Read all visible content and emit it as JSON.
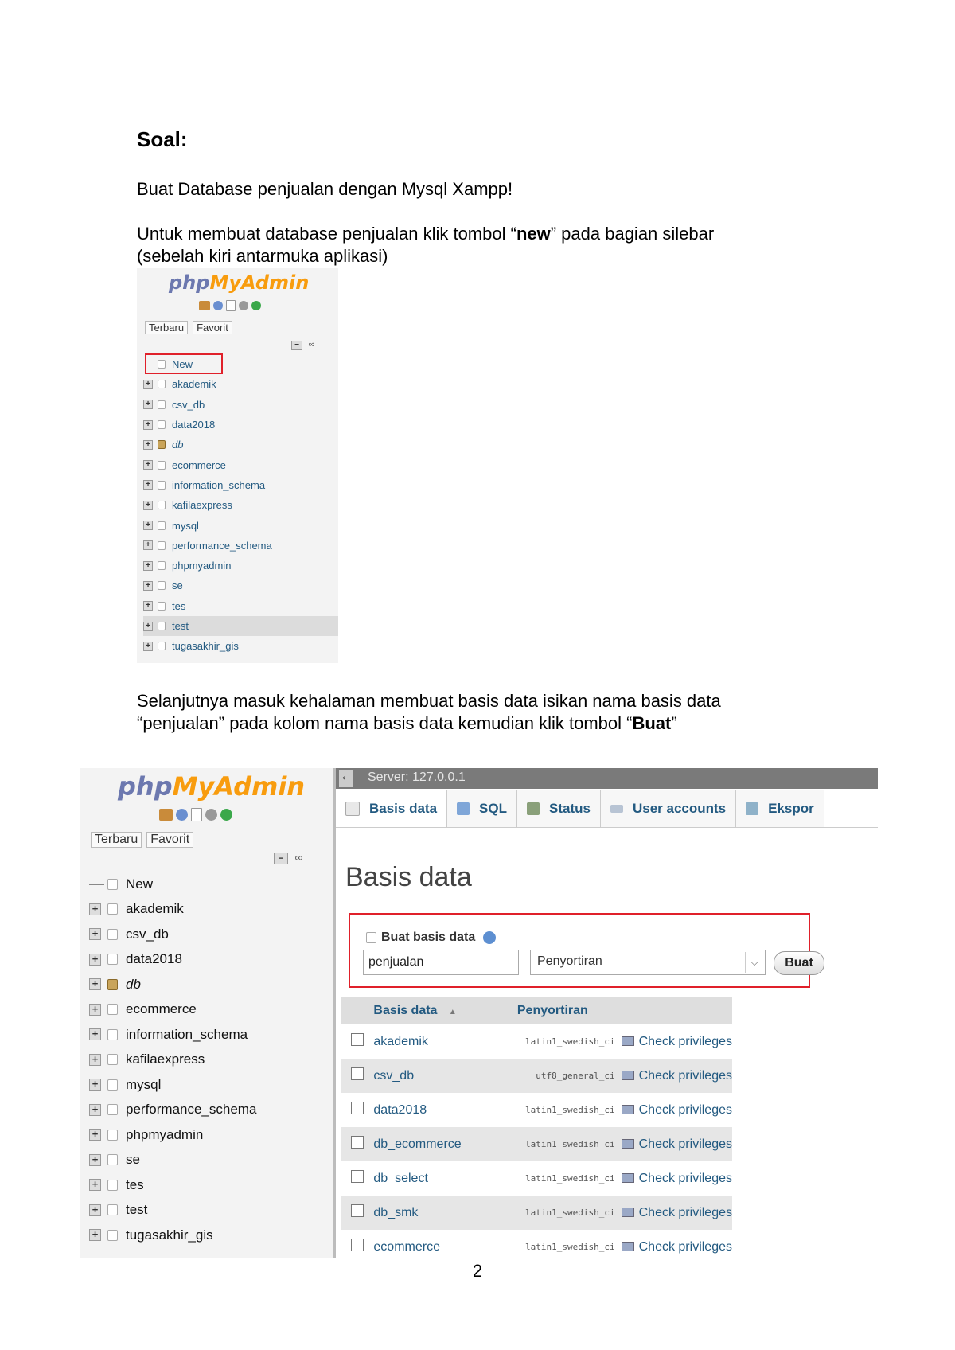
{
  "document": {
    "heading": "Soal:",
    "task": "Buat Database penjualan dengan Mysql Xampp!",
    "step1_before": "Untuk membuat database penjualan klik tombol “",
    "step1_bold": "new",
    "step1_after": "” pada bagian silebar",
    "step1_line2": "(sebelah kiri antarmuka aplikasi)",
    "step2_line1": "Selanjutnya masuk kehalaman membuat basis data isikan nama basis data",
    "step2_line2_before": "“penjualan” pada kolom nama basis data kemudian klik tombol “",
    "step2_bold": "Buat",
    "step2_after": "”",
    "page_number": "2"
  },
  "sidebar": {
    "logo_php": "php",
    "logo_myadmin": "MyAdmin",
    "tab_recent": "Terbaru",
    "tab_favorite": "Favorit",
    "new_label": "New",
    "databases": [
      "akademik",
      "csv_db",
      "data2018",
      "db",
      "ecommerce",
      "information_schema",
      "kafilaexpress",
      "mysql",
      "performance_schema",
      "phpmyadmin",
      "se",
      "tes",
      "test",
      "tugasakhir_gis"
    ]
  },
  "main": {
    "server_label": "Server: 127.0.0.1",
    "tabs": [
      "Basis data",
      "SQL",
      "Status",
      "User accounts",
      "Ekspor"
    ],
    "page_title": "Basis data",
    "create_label": "Buat basis data",
    "db_name_value": "penjualan",
    "collation_placeholder": "Penyortiran",
    "create_button": "Buat",
    "table_headers": {
      "name": "Basis data",
      "collation": "Penyortiran"
    },
    "table_rows": [
      {
        "name": "akademik",
        "collation": "latin1_swedish_ci",
        "privileges": "Check privileges"
      },
      {
        "name": "csv_db",
        "collation": "utf8_general_ci",
        "privileges": "Check privileges"
      },
      {
        "name": "data2018",
        "collation": "latin1_swedish_ci",
        "privileges": "Check privileges"
      },
      {
        "name": "db_ecommerce",
        "collation": "latin1_swedish_ci",
        "privileges": "Check privileges"
      },
      {
        "name": "db_select",
        "collation": "latin1_swedish_ci",
        "privileges": "Check privileges"
      },
      {
        "name": "db_smk",
        "collation": "latin1_swedish_ci",
        "privileges": "Check privileges"
      },
      {
        "name": "ecommerce",
        "collation": "latin1_swedish_ci",
        "privileges": "Check privileges"
      }
    ]
  }
}
